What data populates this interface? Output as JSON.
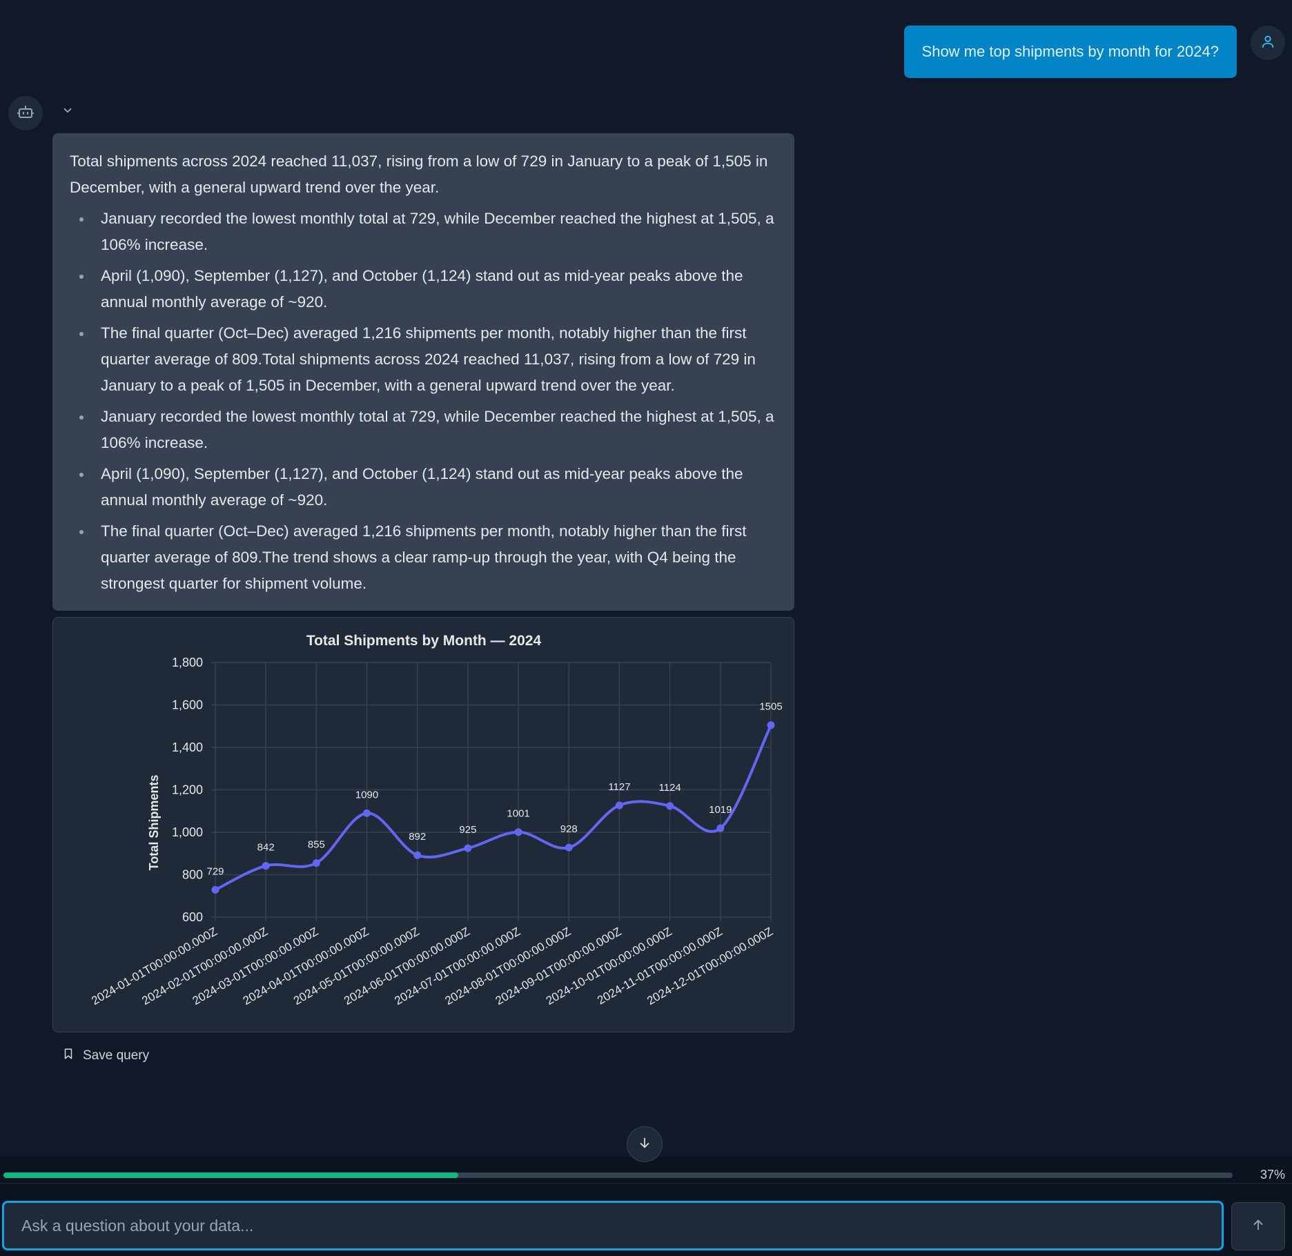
{
  "user_message": "Show me top shipments by month for 2024?",
  "icons": {
    "user": "user-icon",
    "bot": "robot-icon",
    "collapse": "chevron-down-icon",
    "bookmark": "bookmark-icon",
    "scroll": "arrow-down-icon",
    "send": "arrow-up-icon"
  },
  "summary": {
    "intro": "Total shipments across 2024 reached 11,037, rising from a low of 729 in January to a peak of 1,505 in December, with a general upward trend over the year.",
    "bullets": [
      "January recorded the lowest monthly total at 729, while December reached the highest at 1,505, a 106% increase.",
      "April (1,090), September (1,127), and October (1,124) stand out as mid-year peaks above the annual monthly average of ~920.",
      "The final quarter (Oct–Dec) averaged 1,216 shipments per month, notably higher than the first quarter average of 809.Total shipments across 2024 reached 11,037, rising from a low of 729 in January to a peak of 1,505 in December, with a general upward trend over the year.",
      "January recorded the lowest monthly total at 729, while December reached the highest at 1,505, a 106% increase.",
      "April (1,090), September (1,127), and October (1,124) stand out as mid-year peaks above the annual monthly average of ~920.",
      "The final quarter (Oct–Dec) averaged 1,216 shipments per month, notably higher than the first quarter average of 809.The trend shows a clear ramp-up through the year, with Q4 being the strongest quarter for shipment volume."
    ]
  },
  "chart_data": {
    "type": "line",
    "title": "Total Shipments by Month — 2024",
    "xlabel": "",
    "ylabel": "Total Shipments",
    "x": [
      "2024-01-01T00:00:00.000Z",
      "2024-02-01T00:00:00.000Z",
      "2024-03-01T00:00:00.000Z",
      "2024-04-01T00:00:00.000Z",
      "2024-05-01T00:00:00.000Z",
      "2024-06-01T00:00:00.000Z",
      "2024-07-01T00:00:00.000Z",
      "2024-08-01T00:00:00.000Z",
      "2024-09-01T00:00:00.000Z",
      "2024-10-01T00:00:00.000Z",
      "2024-11-01T00:00:00.000Z",
      "2024-12-01T00:00:00.000Z"
    ],
    "series": [
      {
        "values": [
          729,
          842,
          855,
          1090,
          892,
          925,
          1001,
          928,
          1127,
          1124,
          1019,
          1505
        ],
        "color": "#6366f1"
      }
    ],
    "data_labels": [
      "729",
      "842",
      "855",
      "1090",
      "892",
      "925",
      "1001",
      "928",
      "1127",
      "1124",
      "1019",
      "1505"
    ],
    "ylim": [
      600,
      1800
    ],
    "yticks": [
      "600",
      "800",
      "1,000",
      "1,200",
      "1,400",
      "1,600",
      "1,800"
    ],
    "ytick_values": [
      600,
      800,
      1000,
      1200,
      1400,
      1600,
      1800
    ],
    "grid": true,
    "curve": "smooth"
  },
  "save_query_label": "Save query",
  "progress": {
    "value": 0.37,
    "label": "37%",
    "color": "#10b981"
  },
  "input": {
    "placeholder": "Ask a question about your data...",
    "value": ""
  },
  "colors": {
    "accent": "#0284c7",
    "background": "#111827",
    "card": "#374151"
  }
}
